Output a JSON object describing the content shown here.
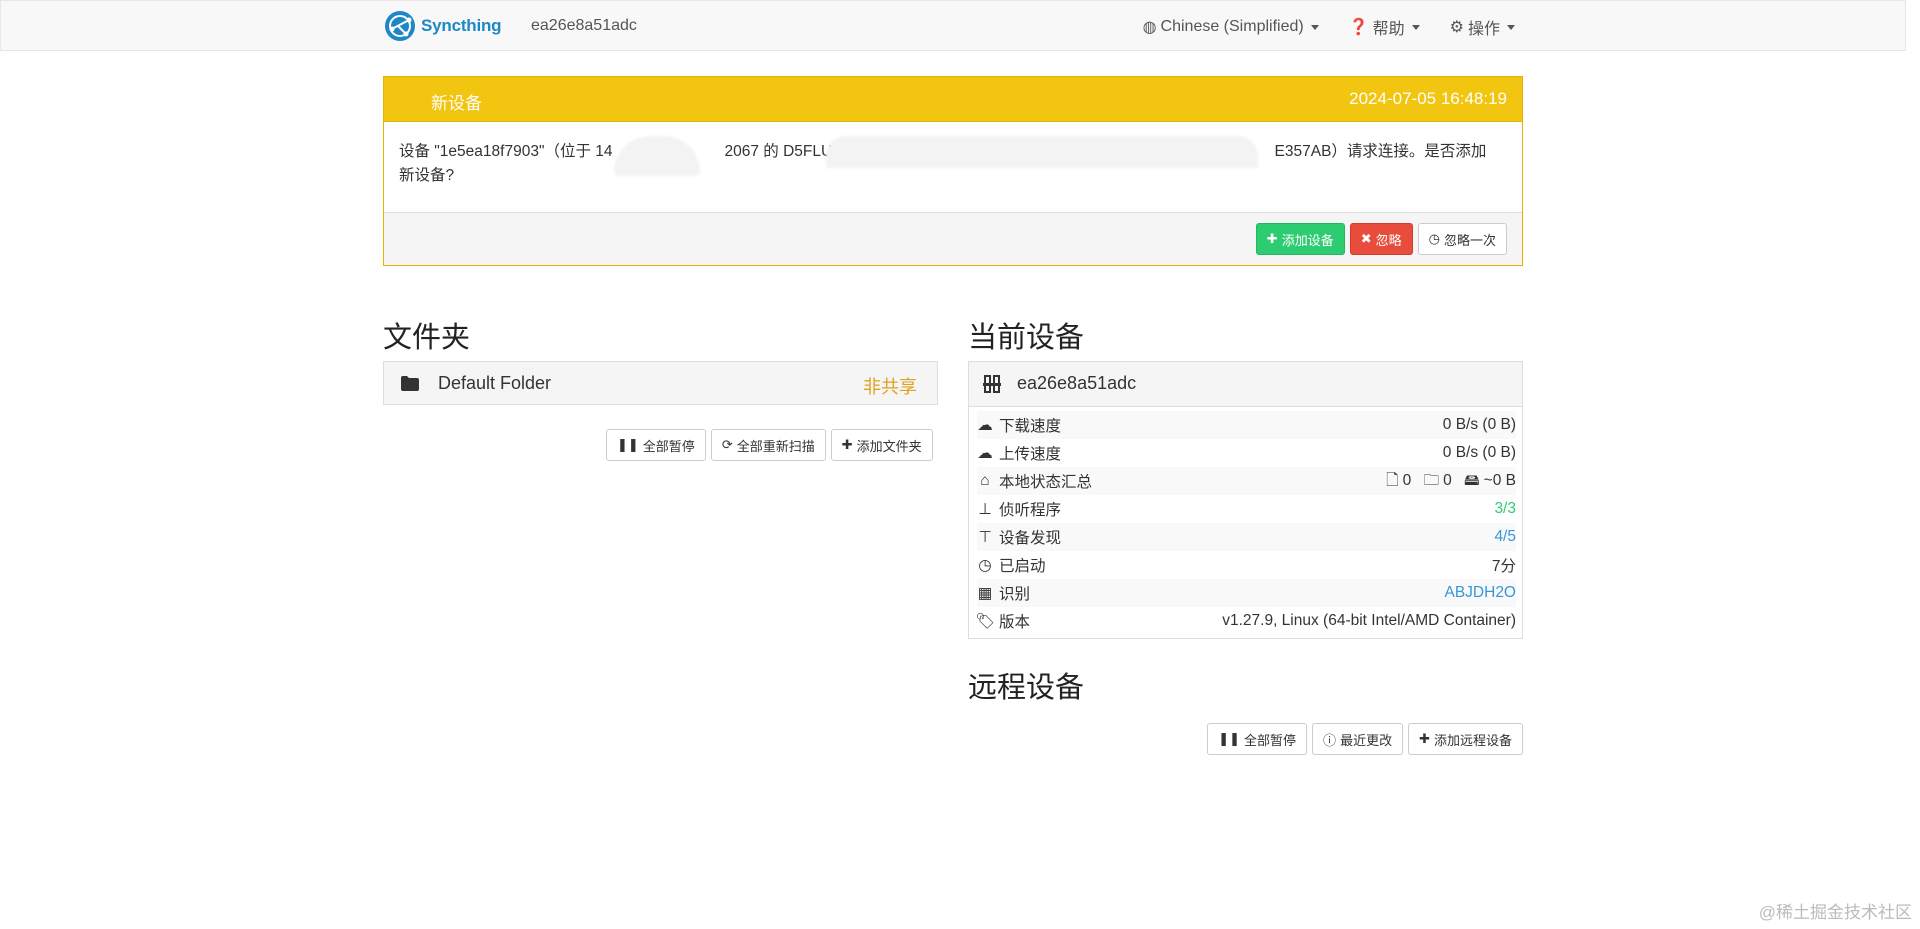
{
  "navbar": {
    "brand": "Syncthing",
    "device_name": "ea26e8a51adc",
    "language": "Chinese (Simplified)",
    "help": "帮助",
    "actions": "操作"
  },
  "notice": {
    "title": "新设备",
    "time": "2024-07-05 16:48:19",
    "message_line1": "设备 \"1e5ea18f7903\"（位于 14",
    "message_mid1": "2067 的 D5FLUS",
    "message_mid2": "E357AB）请求连接。是否添加",
    "message_line2": "新设备?",
    "add_label": "添加设备",
    "ignore_label": "忽略",
    "dismiss_label": "忽略一次"
  },
  "folders": {
    "heading": "文件夹",
    "items": [
      {
        "name": "Default Folder",
        "status": "非共享"
      }
    ],
    "pause_all": "全部暂停",
    "rescan_all": "全部重新扫描",
    "add_folder": "添加文件夹"
  },
  "this_device": {
    "heading": "当前设备",
    "name": "ea26e8a51adc",
    "rows": [
      {
        "label": "下载速度",
        "value": "0 B/s (0 B)"
      },
      {
        "label": "上传速度",
        "value": "0 B/s (0 B)"
      },
      {
        "label": "本地状态汇总",
        "files": "0",
        "dirs": "0",
        "size": "~0 B"
      },
      {
        "label": "侦听程序",
        "value": "3/3"
      },
      {
        "label": "设备发现",
        "value": "4/5"
      },
      {
        "label": "已启动",
        "value": "7分"
      },
      {
        "label": "识别",
        "value": "ABJDH2O"
      },
      {
        "label": "版本",
        "value": "v1.27.9, Linux (64-bit Intel/AMD Container)"
      }
    ]
  },
  "remote_devices": {
    "heading": "远程设备",
    "pause_all": "全部暂停",
    "recent_changes": "最近更改",
    "add_remote": "添加远程设备"
  },
  "watermark": "@稀土掘金技术社区",
  "colors": {
    "warning": "#f2c510",
    "success": "#2ecc71",
    "danger": "#e74c3c",
    "info": "#3498db",
    "brand": "#1e88c7"
  }
}
